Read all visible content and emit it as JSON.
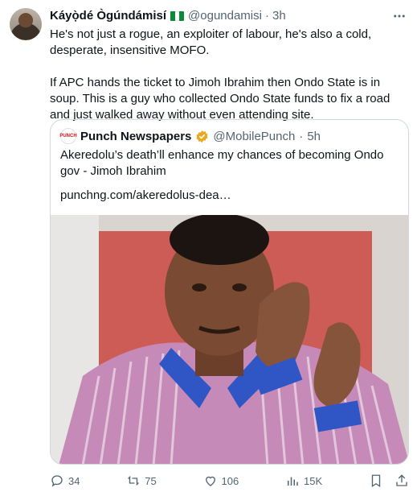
{
  "author": {
    "display_name": "Káyọ̀dé Ògúndámisí",
    "handle": "@ogundamisi",
    "separator": "·",
    "time": "3h",
    "flag": "nigeria-flag-icon"
  },
  "tweet": {
    "paragraphs": [
      "He's not just a rogue, an exploiter of labour, he's also a cold, desperate, insensitive MOFO.",
      "If APC hands the ticket to Jimoh Ibrahim then Ondo State is in soup. This is a guy who collected Ondo State funds to fix a road and just walked away without even attending site."
    ]
  },
  "quote": {
    "name": "Punch Newspapers",
    "avatar_text": "PUNCH",
    "handle": "@MobilePunch",
    "separator": "·",
    "time": "5h",
    "text": "Akeredolu’s death’ll enhance my chances of becoming Ondo gov - Jimoh Ibrahim",
    "link": "punchng.com/akeredolus-dea…"
  },
  "actions": {
    "replies": "34",
    "reposts": "75",
    "likes": "106",
    "views": "15K"
  },
  "colors": {
    "text": "#0f1419",
    "muted": "#536471",
    "border": "#cfd9de",
    "verified": "#e8a81f"
  }
}
